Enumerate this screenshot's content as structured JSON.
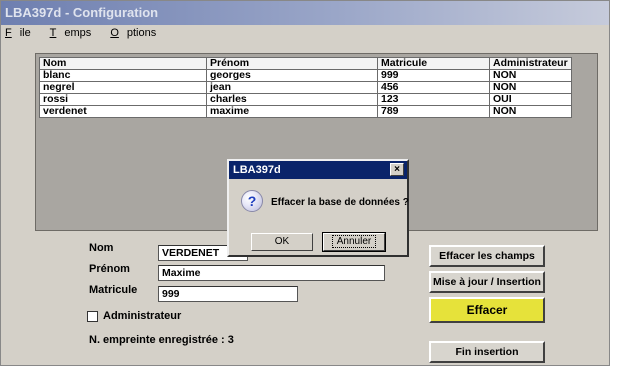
{
  "window": {
    "title": "LBA397d - Configuration"
  },
  "menu": [
    {
      "label": "File",
      "accel": "F",
      "rest": "ile"
    },
    {
      "label": "Temps",
      "accel": "T",
      "rest": "emps"
    },
    {
      "label": "Options",
      "accel": "O",
      "rest": "ptions"
    }
  ],
  "table": {
    "columns": [
      "Nom",
      "Prénom",
      "Matricule",
      "Administrateur"
    ],
    "rows": [
      [
        "blanc",
        "georges",
        "999",
        "NON"
      ],
      [
        "negrel",
        "jean",
        "456",
        "NON"
      ],
      [
        "rossi",
        "charles",
        "123",
        "OUI"
      ],
      [
        "verdenet",
        "maxime",
        "789",
        "NON"
      ]
    ]
  },
  "form": {
    "nom_label": "Nom",
    "nom_value": "VERDENET",
    "prenom_label": "Prénom",
    "prenom_value": "Maxime",
    "matricule_label": "Matricule",
    "matricule_value": "999",
    "admin_label": "Administrateur",
    "admin_checked": false,
    "empreinte_label": "N. empreinte enregistrée :",
    "empreinte_value": "3"
  },
  "buttons": {
    "effacer_champs": "Effacer les champs",
    "mise_a_jour": "Mise à jour / Insertion",
    "effacer": "Effacer",
    "fin_insertion": "Fin insertion"
  },
  "dialog": {
    "title": "LBA397d",
    "close": "×",
    "icon": "question-icon",
    "message": "Effacer la base de données ?",
    "ok": "OK",
    "cancel": "Annuler"
  },
  "colors": {
    "effacer_button": "#e6e23a",
    "dialog_titlebar": "#0a246a",
    "question_icon": "#1f3fbf"
  }
}
